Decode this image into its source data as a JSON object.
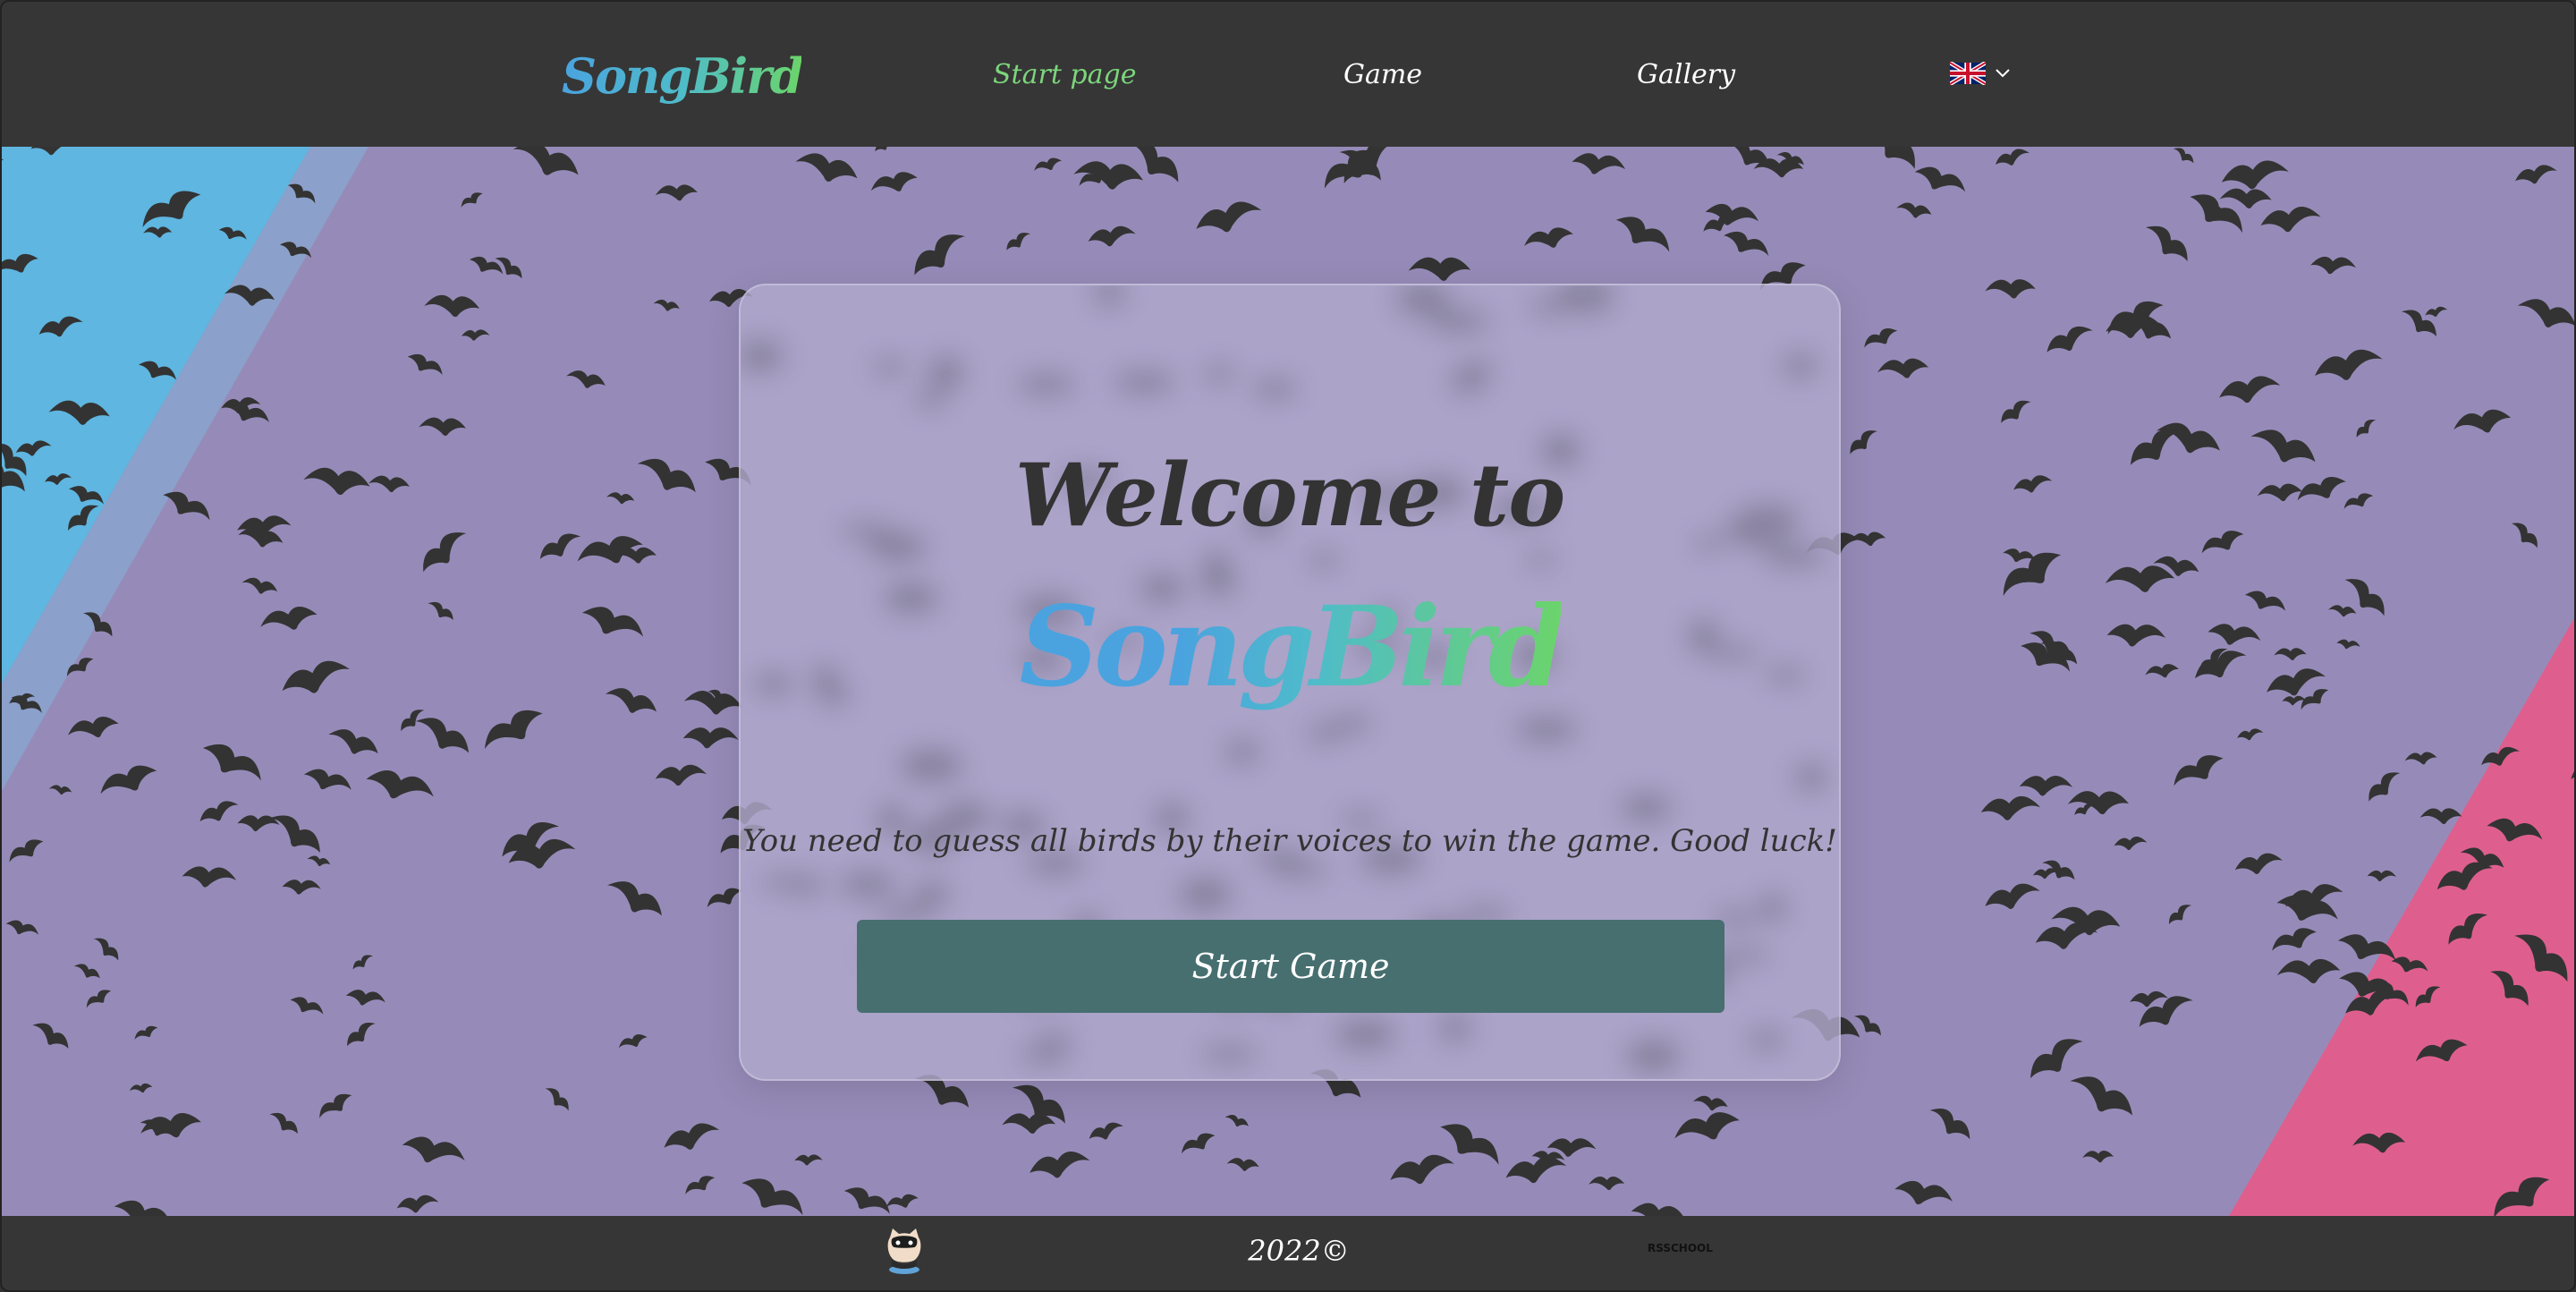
{
  "header": {
    "logo": "SongBird",
    "nav": [
      {
        "label": "Start page",
        "active": true
      },
      {
        "label": "Game",
        "active": false
      },
      {
        "label": "Gallery",
        "active": false
      }
    ],
    "language_icon": "uk-flag-icon"
  },
  "main": {
    "welcome": "Welcome to",
    "logo": "SongBird",
    "description": "You need to guess all birds by their voices to win the game. Good luck!",
    "start_button": "Start Game"
  },
  "footer": {
    "github_icon": "github-icon",
    "year": "2022©",
    "school_logo": "rs-school-logo",
    "school_logo_text": "RSSCHOOL"
  },
  "colors": {
    "header_bg": "#363636",
    "main_bg": "#968bb8",
    "accent_green": "#7cd67c",
    "logo_blue": "#4aa3df",
    "button_bg": "#476f70",
    "stripe_blue": "#5fb6e0",
    "stripe_pink": "#de5f8e"
  }
}
